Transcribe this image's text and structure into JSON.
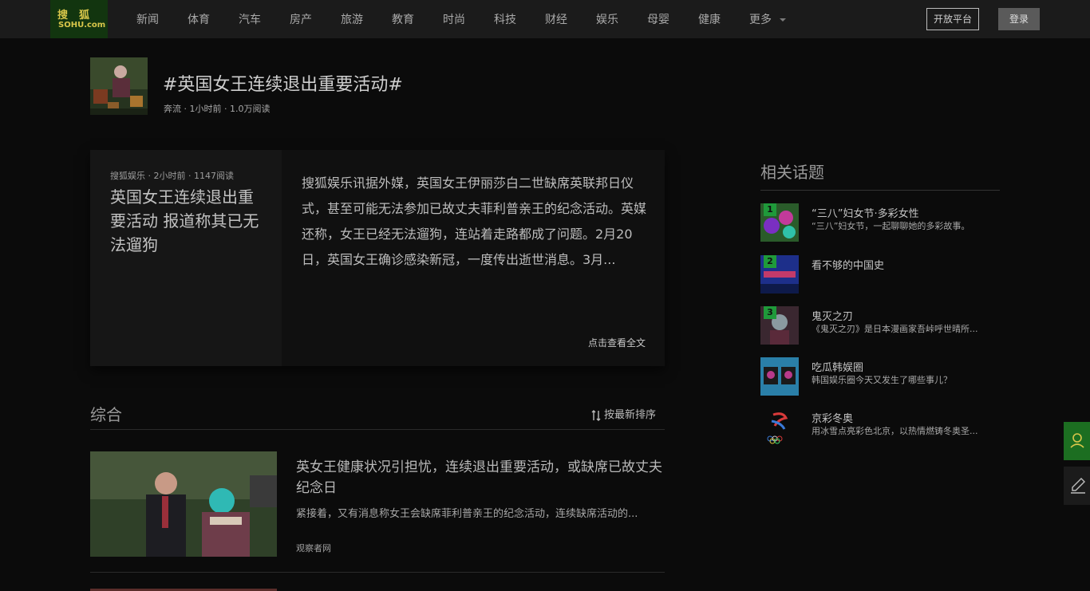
{
  "nav": {
    "logo_top": "搜狐",
    "logo_bottom": "SOHU.com",
    "items": [
      "新闻",
      "体育",
      "汽车",
      "房产",
      "旅游",
      "教育",
      "时尚",
      "科技",
      "财经",
      "娱乐",
      "母婴",
      "健康"
    ],
    "more_label": "更多",
    "outline_button": "开放平台",
    "login_button": "登录"
  },
  "topic": {
    "title": "#英国女王连续退出重要活动#",
    "meta": "奔流 · 1小时前 · 1.0万阅读"
  },
  "lead": {
    "meta": "搜狐娱乐 · 2小时前 · 1147阅读",
    "title": "英国女王连续退出重要活动 报道称其已无法遛狗",
    "text": "搜狐娱乐讯据外媒，英国女王伊丽莎白二世缺席英联邦日仪式，甚至可能无法参加已故丈夫菲利普亲王的纪念活动。英媒还称，女王已经无法遛狗，连站着走路都成了问题。2月20日，英国女王确诊感染新冠，一度传出逝世消息。3月...",
    "more": "点击查看全文"
  },
  "section": {
    "title": "综合",
    "sort_label": "按最新排序"
  },
  "feed": [
    {
      "title": "英女王健康状况引担忧，连续退出重要活动，或缺席已故丈夫纪念日",
      "desc": "紧接着，又有消息称女王会缺席菲利普亲王的纪念活动，连续缺席活动的...",
      "source": "观察者网"
    }
  ],
  "related": {
    "title": "相关话题",
    "items": [
      {
        "rank": "1",
        "name": "“三八”妇女节·多彩女性",
        "desc": "“三八”妇女节，一起聊聊她的多彩故事。",
        "thumb_color": "#2a5b2a"
      },
      {
        "rank": "2",
        "name": "看不够的中国史",
        "desc": "",
        "thumb_color": "#1d2f8a"
      },
      {
        "rank": "3",
        "name": "鬼灭之刃",
        "desc": "《鬼灭之刃》是日本漫画家吾峠呼世晴所...",
        "thumb_color": "#3a2730"
      },
      {
        "rank": "",
        "name": "吃瓜韩娱圈",
        "desc": "韩国娱乐圈今天又发生了哪些事儿？",
        "thumb_color": "#2a7fa8"
      },
      {
        "rank": "",
        "name": "京彩冬奥",
        "desc": "用冰雪点亮彩色北京，以热情燃铸冬奥圣...",
        "thumb_color": "#0b0b0b"
      }
    ]
  },
  "floating": {
    "green_icon": "user-icon",
    "gray_icon": "edit-icon"
  }
}
